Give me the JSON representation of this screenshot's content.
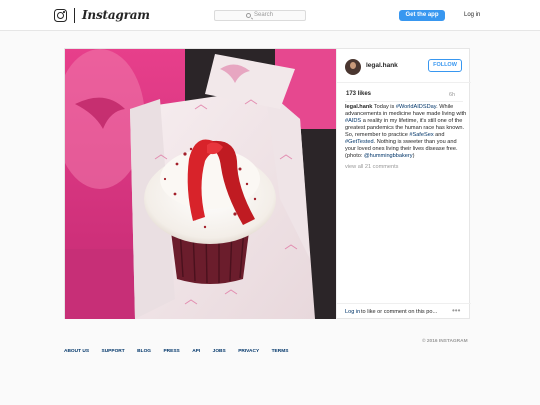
{
  "header": {
    "brand": "Instagram",
    "search_placeholder": "Search",
    "get_app_label": "Get the app",
    "login_label": "Log in"
  },
  "post": {
    "username": "legal.hank",
    "follow_label": "FOLLOW",
    "likes": "173 likes",
    "time": "6h",
    "caption": {
      "user": "legal.hank",
      "t1": " Today is ",
      "tag1": "#WorldAIDSDay",
      "t2": ". While advancements in medicine have made living with ",
      "tag2": "#AIDS",
      "t3": " a reality in my lifetime, it's still one of the greatest pandemics the human race has known. So, remember to practice ",
      "tag3": "#SafeSex",
      "t4": " and ",
      "tag4": "#GetTested",
      "t5": ". Nothing is sweeter than you and your loved ones living their lives disease free. (photo: ",
      "mention": "@hummingbbakery",
      "t6": ")"
    },
    "view_all": "view all 21 comments",
    "login_link": "Log in",
    "comment_prompt": " to like or comment on this po...",
    "more_label": "•••"
  },
  "footer": {
    "links": [
      "ABOUT US",
      "SUPPORT",
      "BLOG",
      "PRESS",
      "API",
      "JOBS",
      "PRIVACY",
      "TERMS"
    ],
    "copyright": "© 2016 INSTAGRAM"
  },
  "colors": {
    "accent": "#3897f0",
    "link": "#003569",
    "ribbon": "#d8232a"
  }
}
